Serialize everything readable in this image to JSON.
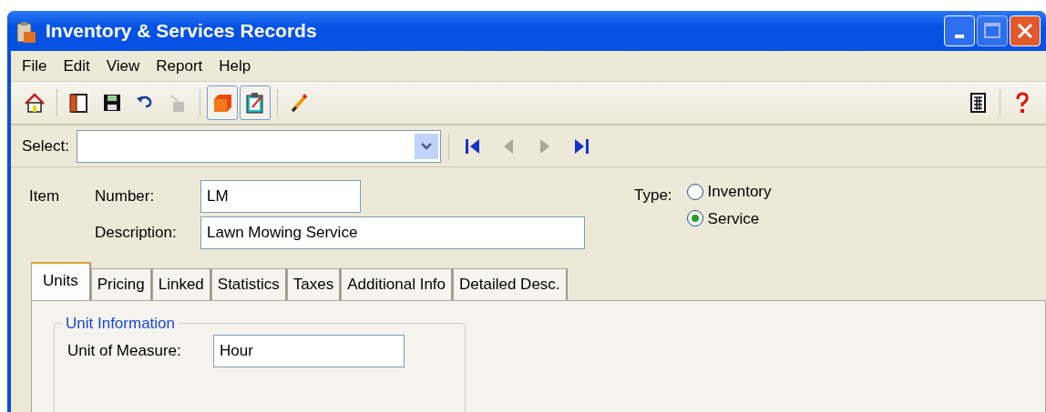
{
  "window": {
    "title": "Inventory & Services Records"
  },
  "menu": [
    {
      "label": "File"
    },
    {
      "label": "Edit"
    },
    {
      "label": "View"
    },
    {
      "label": "Report"
    },
    {
      "label": "Help"
    }
  ],
  "toolbar": [
    {
      "kind": "home",
      "disabled": false,
      "pressed": false
    },
    {
      "kind": "sep"
    },
    {
      "kind": "book",
      "disabled": false,
      "pressed": false
    },
    {
      "kind": "save",
      "disabled": false,
      "pressed": false
    },
    {
      "kind": "undo",
      "disabled": false,
      "pressed": false
    },
    {
      "kind": "trash",
      "disabled": true,
      "pressed": false
    },
    {
      "kind": "sep"
    },
    {
      "kind": "cube",
      "disabled": false,
      "pressed": true
    },
    {
      "kind": "clipboard",
      "disabled": false,
      "pressed": true
    },
    {
      "kind": "sep"
    },
    {
      "kind": "pen",
      "disabled": false,
      "pressed": false
    }
  ],
  "toolbar_right": [
    {
      "kind": "calculator",
      "disabled": false,
      "pressed": false
    },
    {
      "kind": "sep"
    },
    {
      "kind": "help",
      "disabled": false,
      "pressed": false
    }
  ],
  "select": {
    "label": "Select:"
  },
  "navigation": [
    {
      "kind": "first",
      "disabled": false
    },
    {
      "kind": "prev",
      "disabled": true
    },
    {
      "kind": "next",
      "disabled": true
    },
    {
      "kind": "last",
      "disabled": false
    }
  ],
  "item": {
    "label": "Item",
    "number_label": "Number:",
    "number": "LM",
    "description_label": "Description:",
    "description": "Lawn Mowing Service"
  },
  "type": {
    "label": "Type:",
    "options": [
      {
        "label": "Inventory",
        "selected": false
      },
      {
        "label": "Service",
        "selected": true
      }
    ]
  },
  "tabs": [
    {
      "label": "Units",
      "selected": true
    },
    {
      "label": "Pricing",
      "selected": false
    },
    {
      "label": "Linked",
      "selected": false
    },
    {
      "label": "Statistics",
      "selected": false
    },
    {
      "label": "Taxes",
      "selected": false
    },
    {
      "label": "Additional Info",
      "selected": false
    },
    {
      "label": "Detailed Desc.",
      "selected": false
    }
  ],
  "unit_information": {
    "title": "Unit Information",
    "unit_label": "Unit of Measure:",
    "unit": "Hour"
  }
}
